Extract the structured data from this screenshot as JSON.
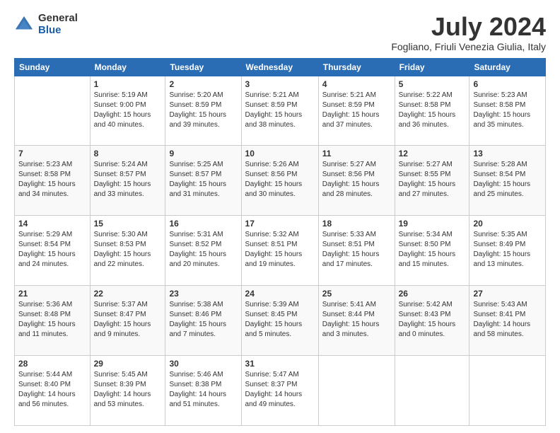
{
  "logo": {
    "general": "General",
    "blue": "Blue"
  },
  "header": {
    "title": "July 2024",
    "location": "Fogliano, Friuli Venezia Giulia, Italy"
  },
  "weekdays": [
    "Sunday",
    "Monday",
    "Tuesday",
    "Wednesday",
    "Thursday",
    "Friday",
    "Saturday"
  ],
  "weeks": [
    [
      {
        "day": "",
        "sunrise": "",
        "sunset": "",
        "daylight": ""
      },
      {
        "day": "1",
        "sunrise": "Sunrise: 5:19 AM",
        "sunset": "Sunset: 9:00 PM",
        "daylight": "Daylight: 15 hours and 40 minutes."
      },
      {
        "day": "2",
        "sunrise": "Sunrise: 5:20 AM",
        "sunset": "Sunset: 8:59 PM",
        "daylight": "Daylight: 15 hours and 39 minutes."
      },
      {
        "day": "3",
        "sunrise": "Sunrise: 5:21 AM",
        "sunset": "Sunset: 8:59 PM",
        "daylight": "Daylight: 15 hours and 38 minutes."
      },
      {
        "day": "4",
        "sunrise": "Sunrise: 5:21 AM",
        "sunset": "Sunset: 8:59 PM",
        "daylight": "Daylight: 15 hours and 37 minutes."
      },
      {
        "day": "5",
        "sunrise": "Sunrise: 5:22 AM",
        "sunset": "Sunset: 8:58 PM",
        "daylight": "Daylight: 15 hours and 36 minutes."
      },
      {
        "day": "6",
        "sunrise": "Sunrise: 5:23 AM",
        "sunset": "Sunset: 8:58 PM",
        "daylight": "Daylight: 15 hours and 35 minutes."
      }
    ],
    [
      {
        "day": "7",
        "sunrise": "Sunrise: 5:23 AM",
        "sunset": "Sunset: 8:58 PM",
        "daylight": "Daylight: 15 hours and 34 minutes."
      },
      {
        "day": "8",
        "sunrise": "Sunrise: 5:24 AM",
        "sunset": "Sunset: 8:57 PM",
        "daylight": "Daylight: 15 hours and 33 minutes."
      },
      {
        "day": "9",
        "sunrise": "Sunrise: 5:25 AM",
        "sunset": "Sunset: 8:57 PM",
        "daylight": "Daylight: 15 hours and 31 minutes."
      },
      {
        "day": "10",
        "sunrise": "Sunrise: 5:26 AM",
        "sunset": "Sunset: 8:56 PM",
        "daylight": "Daylight: 15 hours and 30 minutes."
      },
      {
        "day": "11",
        "sunrise": "Sunrise: 5:27 AM",
        "sunset": "Sunset: 8:56 PM",
        "daylight": "Daylight: 15 hours and 28 minutes."
      },
      {
        "day": "12",
        "sunrise": "Sunrise: 5:27 AM",
        "sunset": "Sunset: 8:55 PM",
        "daylight": "Daylight: 15 hours and 27 minutes."
      },
      {
        "day": "13",
        "sunrise": "Sunrise: 5:28 AM",
        "sunset": "Sunset: 8:54 PM",
        "daylight": "Daylight: 15 hours and 25 minutes."
      }
    ],
    [
      {
        "day": "14",
        "sunrise": "Sunrise: 5:29 AM",
        "sunset": "Sunset: 8:54 PM",
        "daylight": "Daylight: 15 hours and 24 minutes."
      },
      {
        "day": "15",
        "sunrise": "Sunrise: 5:30 AM",
        "sunset": "Sunset: 8:53 PM",
        "daylight": "Daylight: 15 hours and 22 minutes."
      },
      {
        "day": "16",
        "sunrise": "Sunrise: 5:31 AM",
        "sunset": "Sunset: 8:52 PM",
        "daylight": "Daylight: 15 hours and 20 minutes."
      },
      {
        "day": "17",
        "sunrise": "Sunrise: 5:32 AM",
        "sunset": "Sunset: 8:51 PM",
        "daylight": "Daylight: 15 hours and 19 minutes."
      },
      {
        "day": "18",
        "sunrise": "Sunrise: 5:33 AM",
        "sunset": "Sunset: 8:51 PM",
        "daylight": "Daylight: 15 hours and 17 minutes."
      },
      {
        "day": "19",
        "sunrise": "Sunrise: 5:34 AM",
        "sunset": "Sunset: 8:50 PM",
        "daylight": "Daylight: 15 hours and 15 minutes."
      },
      {
        "day": "20",
        "sunrise": "Sunrise: 5:35 AM",
        "sunset": "Sunset: 8:49 PM",
        "daylight": "Daylight: 15 hours and 13 minutes."
      }
    ],
    [
      {
        "day": "21",
        "sunrise": "Sunrise: 5:36 AM",
        "sunset": "Sunset: 8:48 PM",
        "daylight": "Daylight: 15 hours and 11 minutes."
      },
      {
        "day": "22",
        "sunrise": "Sunrise: 5:37 AM",
        "sunset": "Sunset: 8:47 PM",
        "daylight": "Daylight: 15 hours and 9 minutes."
      },
      {
        "day": "23",
        "sunrise": "Sunrise: 5:38 AM",
        "sunset": "Sunset: 8:46 PM",
        "daylight": "Daylight: 15 hours and 7 minutes."
      },
      {
        "day": "24",
        "sunrise": "Sunrise: 5:39 AM",
        "sunset": "Sunset: 8:45 PM",
        "daylight": "Daylight: 15 hours and 5 minutes."
      },
      {
        "day": "25",
        "sunrise": "Sunrise: 5:41 AM",
        "sunset": "Sunset: 8:44 PM",
        "daylight": "Daylight: 15 hours and 3 minutes."
      },
      {
        "day": "26",
        "sunrise": "Sunrise: 5:42 AM",
        "sunset": "Sunset: 8:43 PM",
        "daylight": "Daylight: 15 hours and 0 minutes."
      },
      {
        "day": "27",
        "sunrise": "Sunrise: 5:43 AM",
        "sunset": "Sunset: 8:41 PM",
        "daylight": "Daylight: 14 hours and 58 minutes."
      }
    ],
    [
      {
        "day": "28",
        "sunrise": "Sunrise: 5:44 AM",
        "sunset": "Sunset: 8:40 PM",
        "daylight": "Daylight: 14 hours and 56 minutes."
      },
      {
        "day": "29",
        "sunrise": "Sunrise: 5:45 AM",
        "sunset": "Sunset: 8:39 PM",
        "daylight": "Daylight: 14 hours and 53 minutes."
      },
      {
        "day": "30",
        "sunrise": "Sunrise: 5:46 AM",
        "sunset": "Sunset: 8:38 PM",
        "daylight": "Daylight: 14 hours and 51 minutes."
      },
      {
        "day": "31",
        "sunrise": "Sunrise: 5:47 AM",
        "sunset": "Sunset: 8:37 PM",
        "daylight": "Daylight: 14 hours and 49 minutes."
      },
      {
        "day": "",
        "sunrise": "",
        "sunset": "",
        "daylight": ""
      },
      {
        "day": "",
        "sunrise": "",
        "sunset": "",
        "daylight": ""
      },
      {
        "day": "",
        "sunrise": "",
        "sunset": "",
        "daylight": ""
      }
    ]
  ]
}
